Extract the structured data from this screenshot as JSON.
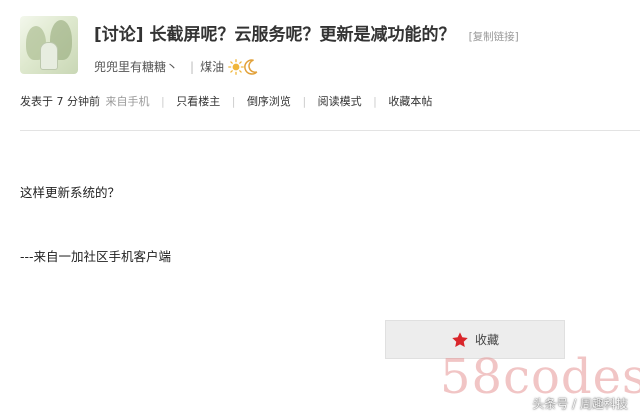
{
  "post": {
    "title": "[讨论] 长截屏呢？云服务呢？更新是减功能的？",
    "copy_link_label": "[复制链接]",
    "author": "兜兜里有糖糖丶",
    "author_separator": "|",
    "user_group": "煤油",
    "weather_icons": [
      "sun-icon",
      "moon-icon"
    ],
    "meta": {
      "posted_time": "发表于 7 分钟前",
      "source": "来自手机",
      "separator": "|",
      "actions": [
        "只看楼主",
        "倒序浏览",
        "阅读模式",
        "收藏本帖"
      ]
    },
    "body_lines": [
      "这样更新系统的？",
      "---来自一加社区手机客户端"
    ],
    "favorite_button": "收藏",
    "favorite_icon": "star-icon"
  },
  "watermark": {
    "site_text": "58codes",
    "credit_text": "头条号 / 周趣科技"
  },
  "colors": {
    "star": "#d9262b",
    "sun": "#f0b63a",
    "moon": "#e2a13a",
    "watermark": "#e69696"
  }
}
